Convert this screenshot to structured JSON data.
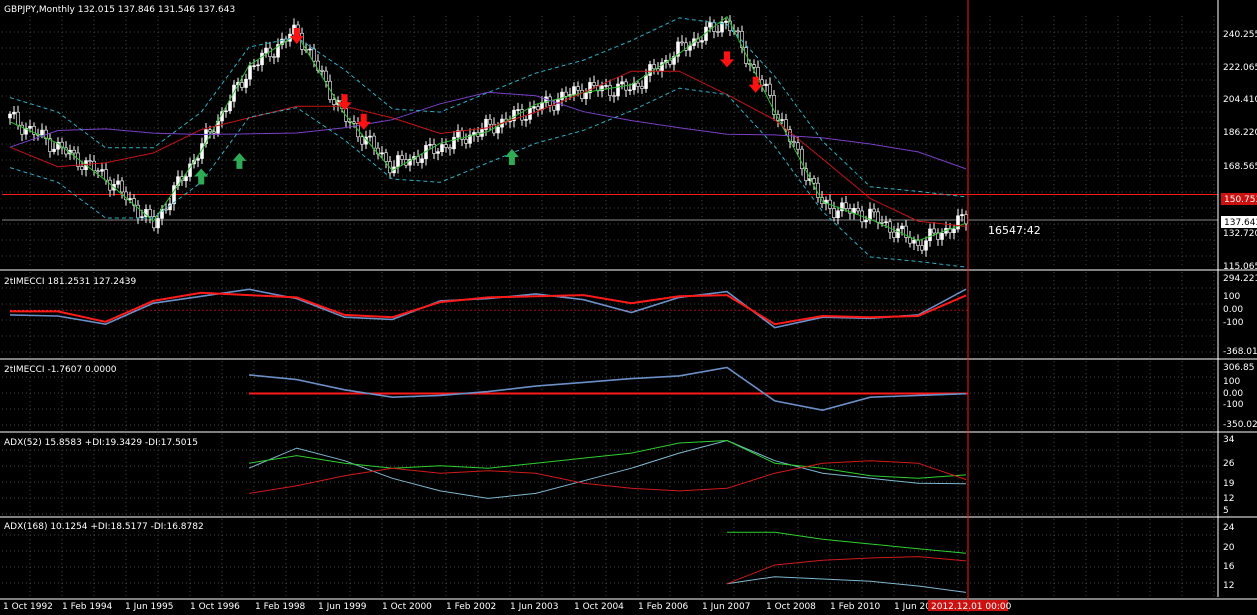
{
  "colors": {
    "background": "#000000",
    "grid": "#3a4a3a",
    "foreground": "#ffffff",
    "bull_candle": "#ffffff",
    "bear_candle": "#000000",
    "ma_fast": "#2fbf2f",
    "ma_slow": "#c81414",
    "ma_long": "#7b3fc9",
    "bands": "#29b0c8",
    "cci_blue": "#6b8fc7",
    "cci_red": "#ff1a1a",
    "adx_main": "#7fb7d0",
    "plus_di": "#2fd02f",
    "minus_di": "#d01a1a",
    "hline": "#ff1a1a",
    "tag_bg": "#cc1111",
    "price_tag_bg": "#ffffff",
    "sell_arrow": "#ff1111",
    "buy_arrow": "#2faa55",
    "dot": "#3a8fe0"
  },
  "header": {
    "symbol_text": "GBPJPY,Monthly  132.015 137.846 131.546 137.643"
  },
  "price_labels": {
    "current_price": "137.643",
    "level_line_price": "150.753",
    "floating_text": "16547:42"
  },
  "x_axis": {
    "labels": [
      "1 Oct 1992",
      "1 Feb 1994",
      "1 Jun 1995",
      "1 Oct 1996",
      "1 Feb 1998",
      "1 Jun 1999",
      "1 Oct 2000",
      "1 Feb 2002",
      "1 Jun 2003",
      "1 Oct 2004",
      "1 Feb 2006",
      "1 Jun 2007",
      "1 Oct 2008",
      "1 Feb 2010",
      "1 Jun 20"
    ],
    "cursor_tag": "2012.12.01 00:00"
  },
  "chart_data": [
    {
      "type": "candlestick",
      "title": "GBPJPY,Monthly",
      "ohlc_last": {
        "open": 132.015,
        "high": 137.846,
        "low": 131.546,
        "close": 137.643
      },
      "y_ticks": [
        "240.255",
        "222.065",
        "204.410",
        "186.220",
        "168.565",
        "132.720",
        "115.065"
      ],
      "ylim": [
        115.065,
        240.255
      ],
      "horizontal_level": 150.753,
      "close_by_year": {
        "x": [
          1992,
          1993,
          1994,
          1995,
          1996,
          1997,
          1998,
          1999,
          2000,
          2001,
          2002,
          2003,
          2004,
          2005,
          2006,
          2007,
          2008,
          2009,
          2010,
          2011,
          2012
        ],
        "close": [
          190,
          175,
          160,
          135,
          175,
          215,
          235,
          190,
          165,
          175,
          185,
          195,
          205,
          205,
          225,
          240,
          195,
          145,
          140,
          125,
          138
        ]
      }
    },
    {
      "type": "line",
      "title": "2tIMECCI 181.2531 127.2439",
      "y_ticks": [
        "294.2217",
        "100",
        "0.00",
        "-100",
        "-368.0153"
      ],
      "ylim": [
        -368.0153,
        294.2217
      ],
      "series": [
        {
          "name": "2tIMECCI",
          "values": [
            -40,
            -50,
            -120,
            60,
            120,
            180,
            100,
            -60,
            -80,
            80,
            100,
            140,
            90,
            -20,
            110,
            160,
            -150,
            -60,
            -70,
            -40,
            181
          ]
        },
        {
          "name": "2tIMECCI",
          "values": [
            -10,
            -10,
            -100,
            80,
            150,
            130,
            110,
            -40,
            -60,
            70,
            110,
            120,
            130,
            60,
            120,
            130,
            -120,
            -50,
            -60,
            -50,
            127
          ]
        }
      ]
    },
    {
      "type": "line",
      "title": "2tIMECCI -1.7607 0.0000",
      "y_ticks": [
        "306.85",
        "100",
        "0.00",
        "-100",
        "-350.026"
      ],
      "ylim": [
        -350.026,
        306.85
      ],
      "series": [
        {
          "name": "2tIMECCI",
          "values": [
            null,
            null,
            null,
            null,
            null,
            200,
            150,
            40,
            -40,
            -20,
            20,
            80,
            120,
            160,
            190,
            280,
            -80,
            -180,
            -40,
            -20,
            -1.76
          ]
        },
        {
          "name": "2tIMECCI",
          "values": [
            null,
            null,
            null,
            null,
            null,
            0,
            0,
            0,
            0,
            0,
            0,
            0,
            0,
            0,
            0,
            0,
            0,
            0,
            0,
            0,
            0
          ]
        }
      ]
    },
    {
      "type": "line",
      "title": "ADX(52) 15.8583 +DI:19.3429 -DI:17.5015",
      "y_ticks": [
        "34",
        "26",
        "19",
        "12",
        "5"
      ],
      "ylim": [
        5,
        34
      ],
      "series": [
        {
          "name": "ADX(52)",
          "values": [
            null,
            null,
            null,
            null,
            null,
            22,
            30,
            25,
            18,
            13,
            10,
            12,
            17,
            22,
            28,
            33,
            25,
            20,
            18,
            16,
            15.86
          ]
        },
        {
          "name": "+DI",
          "values": [
            null,
            null,
            null,
            null,
            null,
            24,
            27,
            24,
            22,
            23,
            22,
            24,
            26,
            28,
            32,
            33,
            24,
            22,
            19,
            18,
            19.34
          ]
        },
        {
          "name": "-DI",
          "values": [
            null,
            null,
            null,
            null,
            null,
            12,
            15,
            19,
            22,
            20,
            21,
            20,
            16,
            14,
            13,
            14,
            20,
            24,
            25,
            24,
            17.5
          ]
        }
      ]
    },
    {
      "type": "line",
      "title": "ADX(168) 10.1254 +DI:18.5177 -DI:16.8782",
      "y_ticks": [
        "24",
        "20",
        "16",
        "12"
      ],
      "ylim": [
        10,
        25
      ],
      "series": [
        {
          "name": "ADX(168)",
          "values": [
            null,
            null,
            null,
            null,
            null,
            null,
            null,
            null,
            null,
            null,
            null,
            null,
            null,
            null,
            null,
            12,
            13.5,
            13,
            12.5,
            11.5,
            10.13
          ]
        },
        {
          "name": "+DI",
          "values": [
            null,
            null,
            null,
            null,
            null,
            null,
            null,
            null,
            null,
            null,
            null,
            null,
            null,
            null,
            null,
            23,
            23,
            21.5,
            20.5,
            19.5,
            18.52
          ]
        },
        {
          "name": "-DI",
          "values": [
            null,
            null,
            null,
            null,
            null,
            null,
            null,
            null,
            null,
            null,
            null,
            null,
            null,
            null,
            null,
            12,
            16,
            17,
            17.5,
            17.8,
            16.88
          ]
        }
      ]
    }
  ]
}
